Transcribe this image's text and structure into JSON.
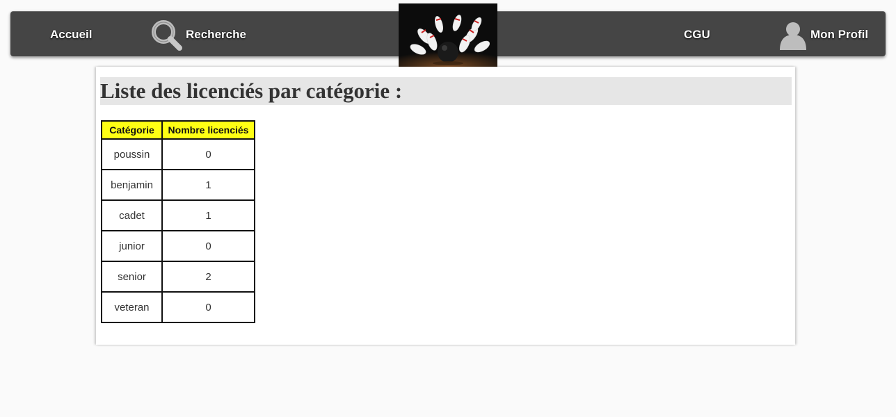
{
  "nav": {
    "accueil": "Accueil",
    "recherche": "Recherche",
    "cgu": "CGU",
    "profil": "Mon Profil",
    "recherche_icon": "magnifier-icon",
    "profil_icon": "user-silhouette-icon"
  },
  "logo": {
    "icon": "bowling-pins-logo"
  },
  "main": {
    "title": "Liste des licenciés par catégorie :",
    "table": {
      "headers": [
        "Catégorie",
        "Nombre licenciés"
      ],
      "rows": [
        [
          "poussin",
          "0"
        ],
        [
          "benjamin",
          "1"
        ],
        [
          "cadet",
          "1"
        ],
        [
          "junior",
          "0"
        ],
        [
          "senior",
          "2"
        ],
        [
          "veteran",
          "0"
        ]
      ]
    }
  },
  "colors": {
    "navbar": "#454545",
    "table_header": "#ffff14",
    "title_background": "#e6e6e6"
  }
}
